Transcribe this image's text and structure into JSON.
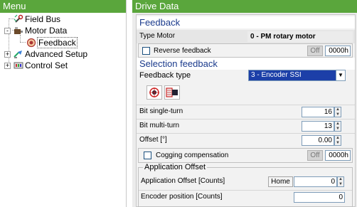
{
  "menu": {
    "title": "Menu",
    "items": [
      {
        "label": "Field Bus",
        "expander": "",
        "icon": "wrench-icon"
      },
      {
        "label": "Motor Data",
        "expander": "-",
        "icon": "motor-icon"
      },
      {
        "label": "Feedback",
        "expander": "",
        "icon": "feedback-icon",
        "selected": true
      },
      {
        "label": "Advanced Setup",
        "expander": "+",
        "icon": "advanced-setup-icon"
      },
      {
        "label": "Control Set",
        "expander": "+",
        "icon": "control-set-icon"
      }
    ]
  },
  "drive": {
    "title": "Drive Data",
    "feedback_title": "Feedback",
    "type_motor_label": "Type Motor",
    "type_motor_value": "0 - PM rotary motor",
    "reverse_feedback_label": "Reverse feedback",
    "reverse_feedback_toggle": "Off",
    "reverse_feedback_hex": "0000h",
    "selection_title": "Selection feedback",
    "feedback_type_label": "Feedback type",
    "feedback_type_value": "3 - Encoder SSI",
    "bit_single_turn_label": "Bit single-turn",
    "bit_single_turn_value": "16",
    "bit_multi_turn_label": "Bit multi-turn",
    "bit_multi_turn_value": "13",
    "offset_label": "Offset [°]",
    "offset_value": "0.00",
    "cogging_label": "Cogging compensation",
    "cogging_toggle": "Off",
    "cogging_hex": "0000h",
    "app_offset_title": "Application Offset",
    "app_offset_label": "Application Offset [Counts]",
    "home_button": "Home",
    "app_offset_value": "0",
    "encoder_position_label": "Encoder position [Counts]",
    "encoder_position_value": "0"
  },
  "colors": {
    "header_green": "#5aa63c",
    "section_blue": "#1a3a8c",
    "combo_selected": "#1c3fa8"
  }
}
